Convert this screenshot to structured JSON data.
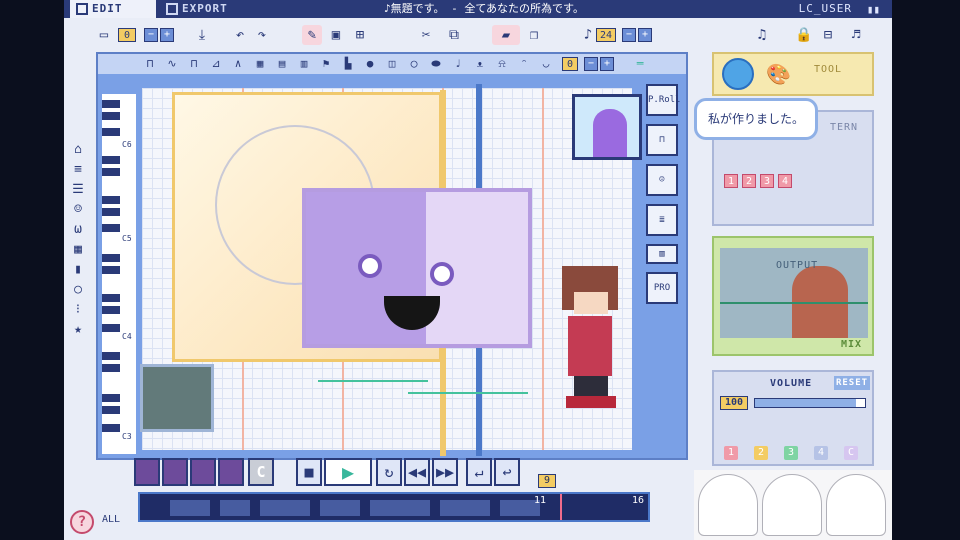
{
  "topbar": {
    "tab_edit": "EDIT",
    "tab_export": "EXPORT",
    "song_title": "♪無題です。 - 全てあなたの所為です。",
    "user_name": "LC_USER"
  },
  "toolbar": {
    "counter_value": "0",
    "tempo_value": "24"
  },
  "wave_bar": {
    "counter_value": "0"
  },
  "piano": {
    "labels": [
      "C6",
      "C5",
      "C4",
      "C3"
    ]
  },
  "right_tools": {
    "proll_label": "P.Roll",
    "pro_label": "PRO"
  },
  "side_panels": {
    "tool_label": "TOOL",
    "speech_bubble": "私が作りました。",
    "pattern_label": "TERN",
    "pattern_numbers": [
      "1",
      "2",
      "3",
      "4"
    ],
    "output_label": "OUTPUT",
    "mix_label": "MIX",
    "volume_label": "VOLUME",
    "reset_label": "RESET",
    "volume_value": "100",
    "volume_level": 0.92,
    "channels": [
      "1",
      "2",
      "3",
      "4",
      "C"
    ]
  },
  "transport": {
    "thumb_c_label": "C",
    "tempo_small": "9"
  },
  "timeline": {
    "marker_a": "11",
    "marker_b": "16",
    "all_label": "ALL"
  },
  "colors": {
    "accent": "#2a3a78",
    "play": "#38b79c",
    "highlight": "#f3cc63"
  }
}
